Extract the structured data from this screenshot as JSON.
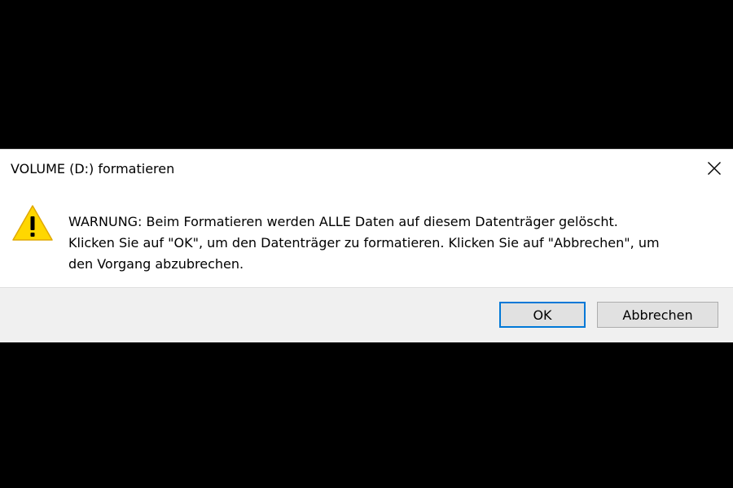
{
  "dialog": {
    "title": "VOLUME (D:) formatieren",
    "close_icon": "close-icon",
    "warning_icon": "warning-icon",
    "message": "WARNUNG: Beim Formatieren werden ALLE Daten auf diesem Datenträger gelöscht.\nKlicken Sie auf \"OK\", um den Datenträger zu formatieren. Klicken Sie auf \"Abbrechen\", um\nden Vorgang abzubrechen.",
    "buttons": {
      "ok_label": "OK",
      "cancel_label": "Abbrechen"
    },
    "colors": {
      "accent": "#0078d7",
      "warning_fill": "#ffd700",
      "footer_bg": "#f0f0f0"
    }
  }
}
